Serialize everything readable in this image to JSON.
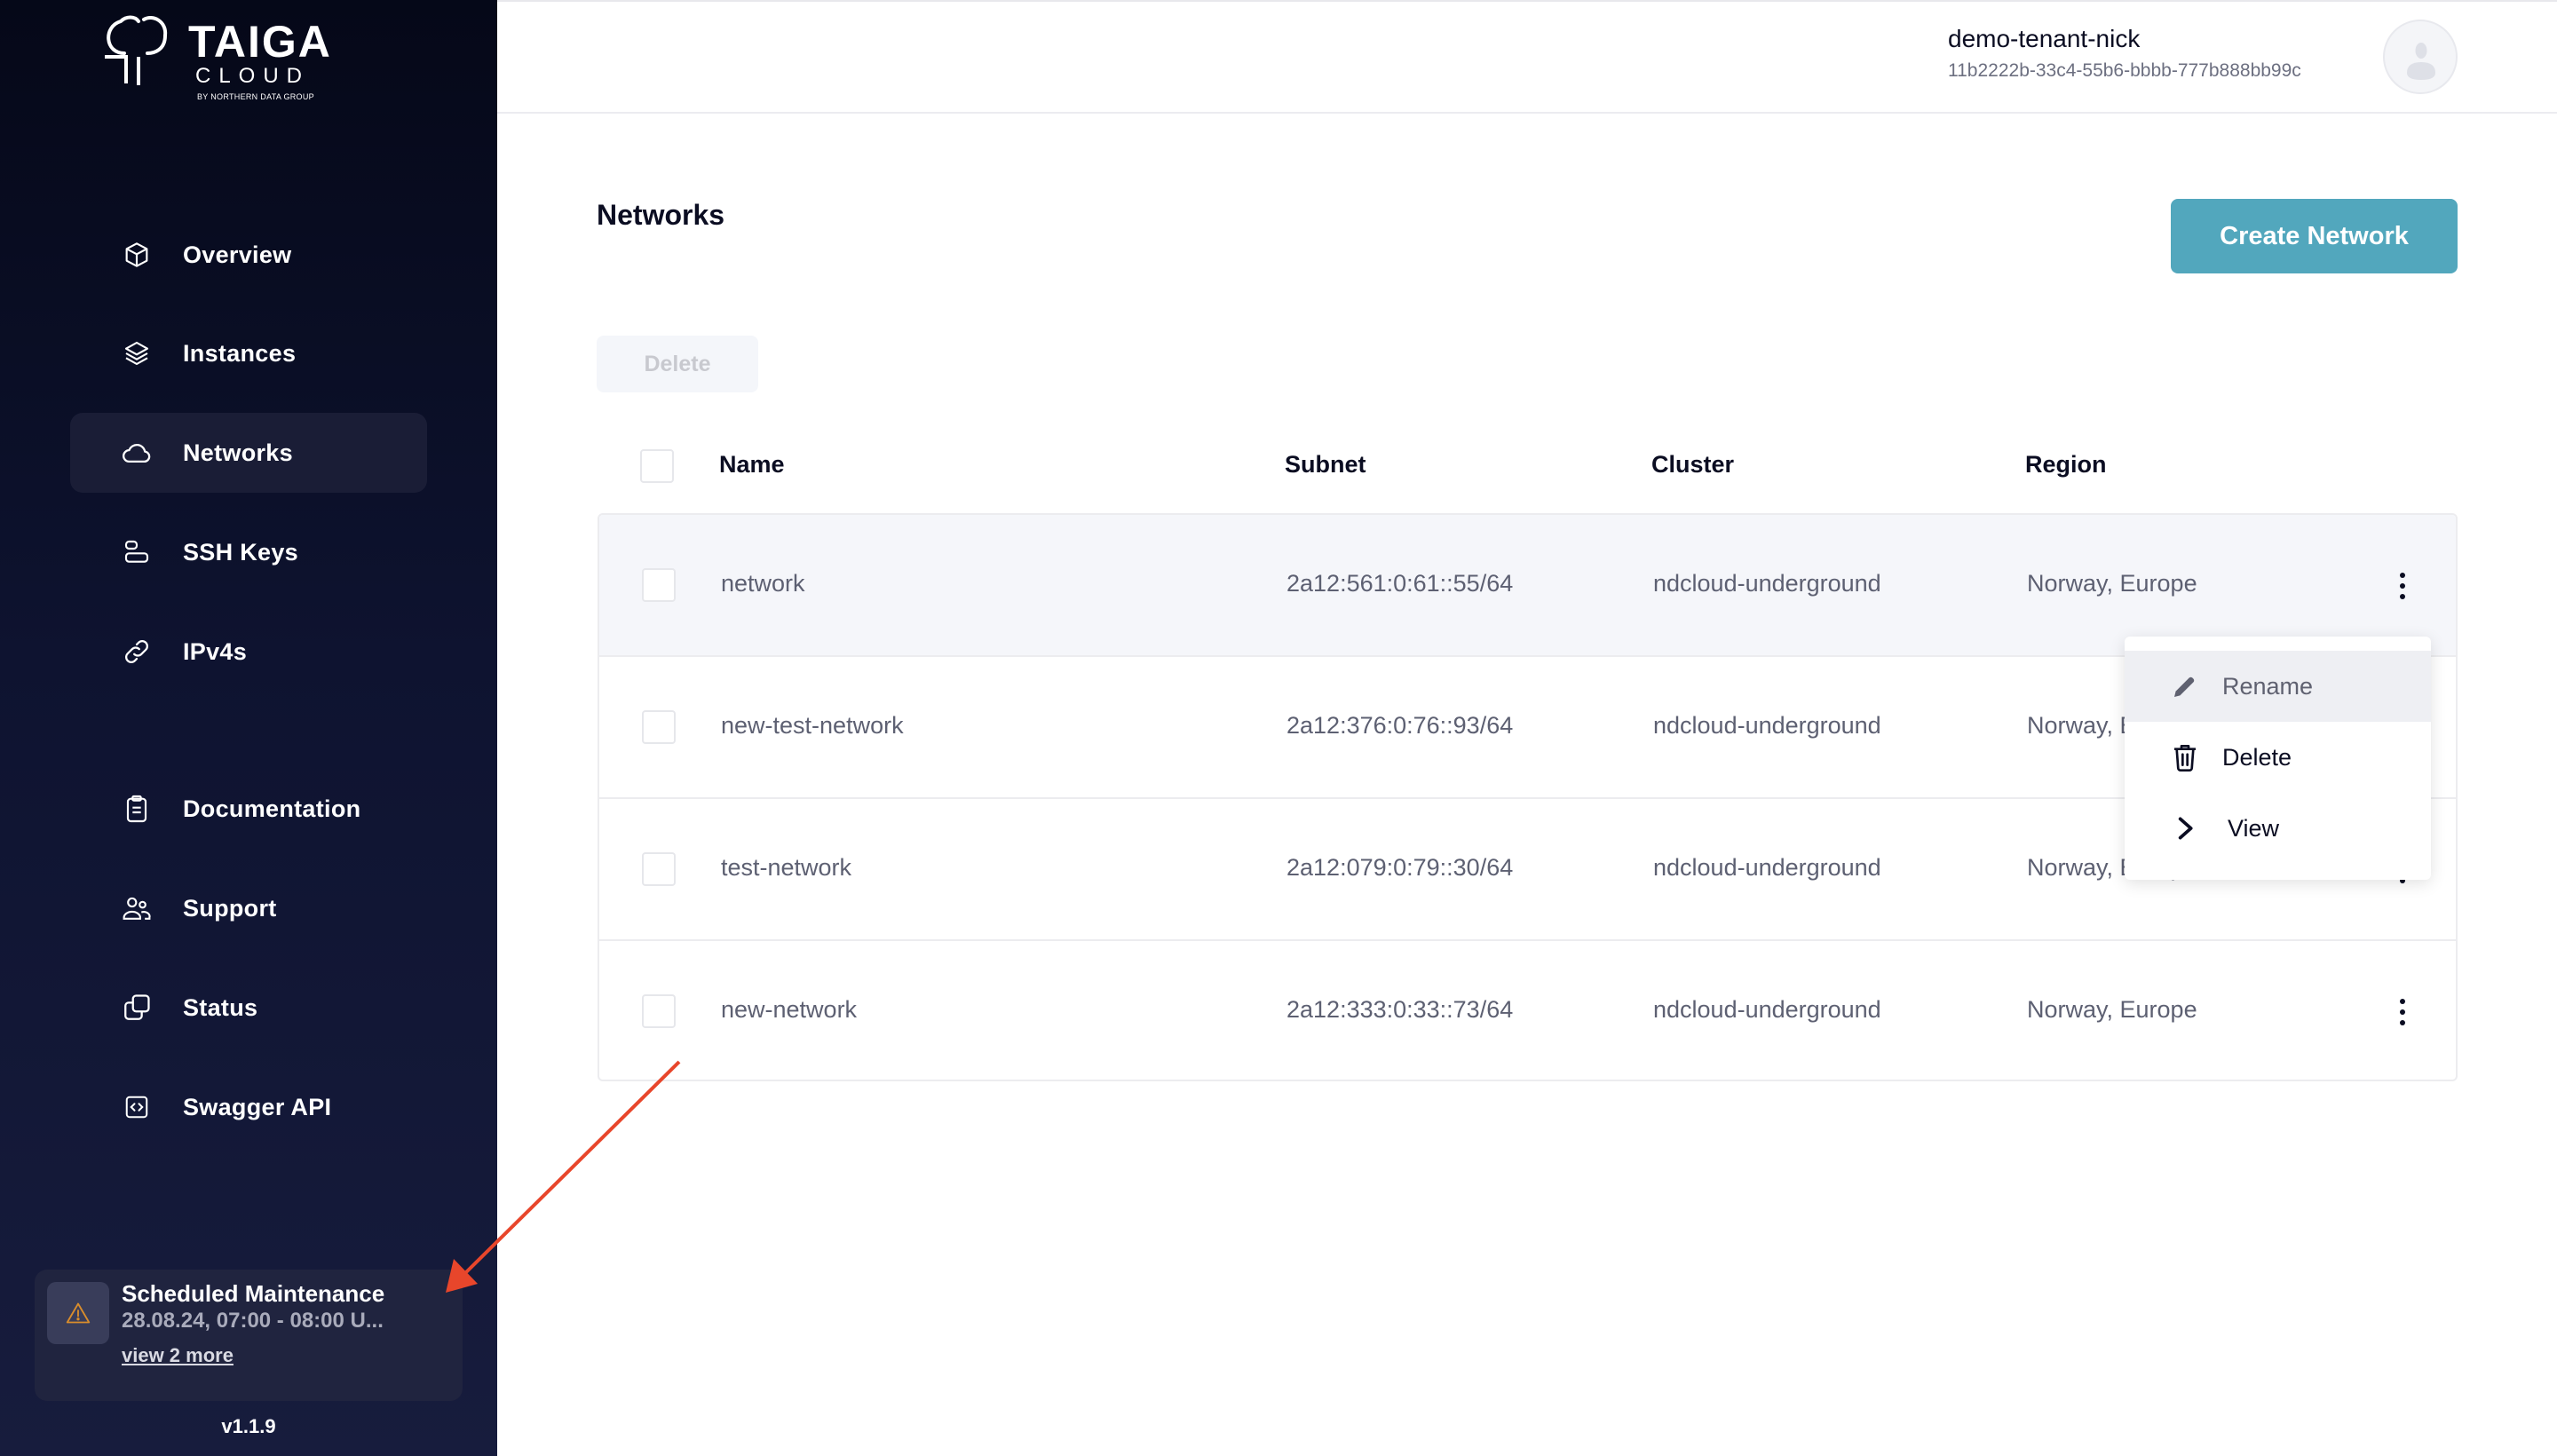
{
  "brand": {
    "name": "TAIGA",
    "sub": "CLOUD",
    "tagline": "BY NORTHERN DATA GROUP"
  },
  "sidebar": {
    "items": [
      {
        "label": "Overview",
        "icon": "cube-icon",
        "active": false
      },
      {
        "label": "Instances",
        "icon": "layers-icon",
        "active": false
      },
      {
        "label": "Networks",
        "icon": "cloud-icon",
        "active": true
      },
      {
        "label": "SSH Keys",
        "icon": "key-stack-icon",
        "active": false
      },
      {
        "label": "IPv4s",
        "icon": "link-icon",
        "active": false
      },
      {
        "label": "Documentation",
        "icon": "clipboard-icon",
        "active": false
      },
      {
        "label": "Support",
        "icon": "users-icon",
        "active": false
      },
      {
        "label": "Status",
        "icon": "copy-icon",
        "active": false
      },
      {
        "label": "Swagger API",
        "icon": "code-icon",
        "active": false
      }
    ],
    "maintenance": {
      "title": "Scheduled Maintenance",
      "time": "28.08.24, 07:00 - 08:00 U...",
      "link": "view 2 more",
      "icon": "warning-icon",
      "icon_color": "#d98d2c"
    },
    "version": "v1.1.9"
  },
  "header": {
    "tenant_name": "demo-tenant-nick",
    "tenant_id": "11b2222b-33c4-55b6-bbbb-777b888bb99c"
  },
  "main": {
    "title": "Networks",
    "create_button": "Create Network",
    "delete_button": "Delete",
    "accent_color": "#52a7bd",
    "columns": [
      "Name",
      "Subnet",
      "Cluster",
      "Region"
    ],
    "rows": [
      {
        "name": "network",
        "subnet": "2a12:561:0:61::55/64",
        "cluster": "ndcloud-underground",
        "region": "Norway, Europe"
      },
      {
        "name": "new-test-network",
        "subnet": "2a12:376:0:76::93/64",
        "cluster": "ndcloud-underground",
        "region": "Norway, Europe"
      },
      {
        "name": "test-network",
        "subnet": "2a12:079:0:79::30/64",
        "cluster": "ndcloud-underground",
        "region": "Norway, Europe"
      },
      {
        "name": "new-network",
        "subnet": "2a12:333:0:33::73/64",
        "cluster": "ndcloud-underground",
        "region": "Norway, Europe"
      }
    ],
    "row_menu": {
      "items": [
        {
          "label": "Rename",
          "icon": "pencil-icon"
        },
        {
          "label": "Delete",
          "icon": "trash-icon"
        },
        {
          "label": "View",
          "icon": "chevron-right-icon"
        }
      ]
    }
  },
  "annotation": {
    "color": "#e8462b"
  }
}
